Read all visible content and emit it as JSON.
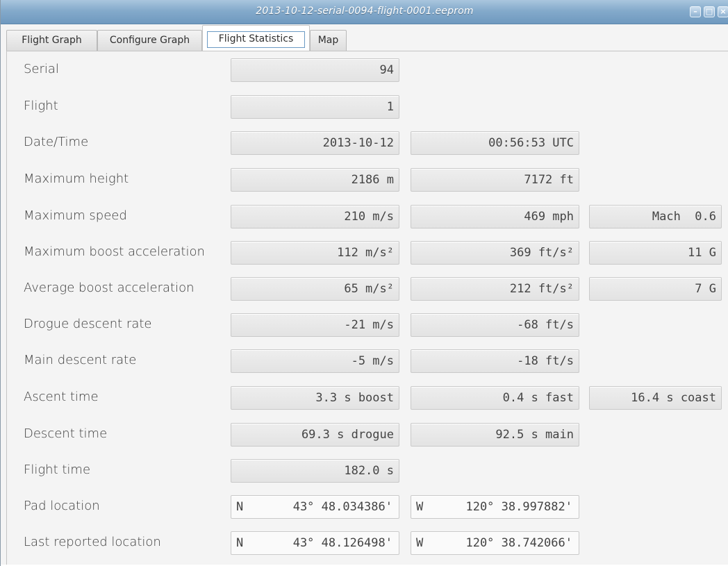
{
  "window": {
    "title": "2013-10-12-serial-0094-flight-0001.eeprom",
    "controls": [
      "minimize-icon",
      "maximize-icon",
      "close-icon"
    ]
  },
  "tabs": [
    {
      "label": "Flight Graph",
      "selected": false
    },
    {
      "label": "Configure Graph",
      "selected": false
    },
    {
      "label": "Flight Statistics",
      "selected": true
    },
    {
      "label": "Map",
      "selected": false
    }
  ],
  "stats": {
    "serial": {
      "label": "Serial",
      "v1": "94"
    },
    "flight": {
      "label": "Flight",
      "v1": "1"
    },
    "datetime": {
      "label": "Date/Time",
      "v1": "2013-10-12",
      "v2": "00:56:53 UTC"
    },
    "max_height": {
      "label": "Maximum height",
      "v1": "2186 m",
      "v2": "7172 ft"
    },
    "max_speed": {
      "label": "Maximum speed",
      "v1": "210 m/s",
      "v2": "469 mph",
      "v3": "Mach  0.6"
    },
    "max_boost": {
      "label": "Maximum boost acceleration",
      "v1": "112 m/s²",
      "v2": "369 ft/s²",
      "v3": "11 G"
    },
    "avg_boost": {
      "label": "Average boost acceleration",
      "v1": "65 m/s²",
      "v2": "212 ft/s²",
      "v3": "7 G"
    },
    "drogue_rate": {
      "label": "Drogue descent rate",
      "v1": "-21 m/s",
      "v2": "-68 ft/s"
    },
    "main_rate": {
      "label": "Main descent rate",
      "v1": "-5 m/s",
      "v2": "-18 ft/s"
    },
    "ascent_time": {
      "label": "Ascent time",
      "v1": "3.3 s boost",
      "v2": "0.4 s fast",
      "v3": "16.4 s coast"
    },
    "descent_time": {
      "label": "Descent time",
      "v1": "69.3 s drogue",
      "v2": "92.5 s main"
    },
    "flight_time": {
      "label": "Flight time",
      "v1": "182.0 s"
    },
    "pad_location": {
      "label": "Pad location",
      "lat_hemi": "N",
      "lat": "43° 48.034386'",
      "lon_hemi": "W",
      "lon": "120° 38.997882'"
    },
    "last_location": {
      "label": "Last reported location",
      "lat_hemi": "N",
      "lat": "43° 48.126498'",
      "lon_hemi": "W",
      "lon": "120° 38.742066'"
    }
  }
}
